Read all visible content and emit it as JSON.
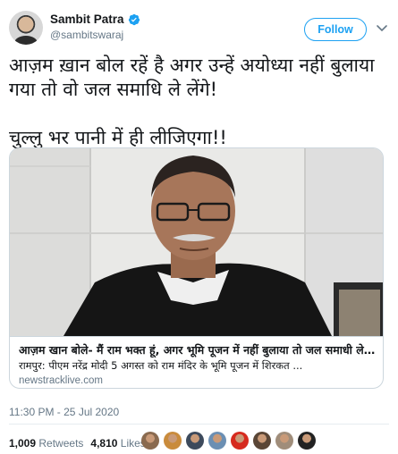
{
  "author": {
    "name": "Sambit Patra",
    "handle": "@sambitswaraj"
  },
  "follow_label": "Follow",
  "tweet_text": "आज़म ख़ान बोल रहें है अगर उन्हें अयोध्या नहीं बुलाया गया तो वो जल समाधि ले लेंगे!\n\nचुल्लु भर पानी में ही लीजिएगा!!",
  "card": {
    "title": "आज़म खान बोले- मैं राम भक्त हूं, अगर भूमि पूजन में नहीं बुलाया तो जल समाधी ले लूंगा",
    "description": "रामपुर: पीएम नरेंद्र मोदी 5 अगस्त को राम मंदिर के भूमि पूजन में शिरकत ...",
    "domain": "newstracklive.com"
  },
  "timestamp": "11:30 PM - 25 Jul 2020",
  "stats": {
    "retweets_count": "1,009",
    "retweets_label": "Retweets",
    "likes_count": "4,810",
    "likes_label": "Likes"
  },
  "liker_colors": [
    "#8a6a4f",
    "#c98b3c",
    "#3d4a5c",
    "#6b8fb3",
    "#d62a1e",
    "#5a4636",
    "#a08d7a",
    "#222222"
  ],
  "colors": {
    "accent": "#1da1f2",
    "secondary_text": "#657786"
  }
}
